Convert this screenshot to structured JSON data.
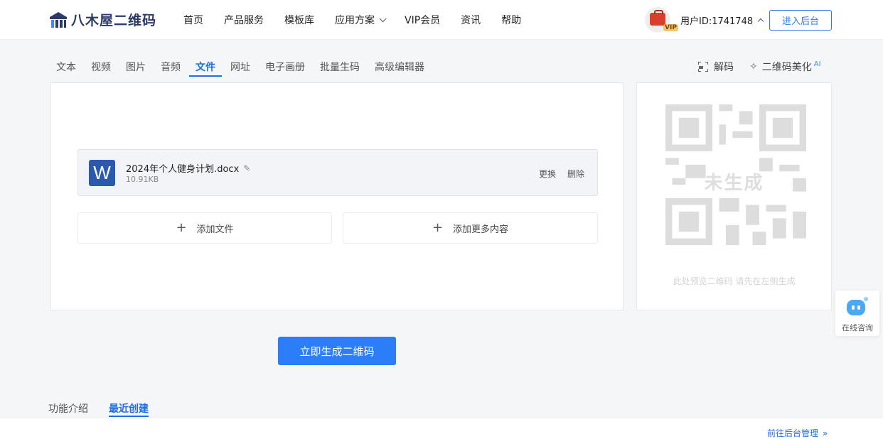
{
  "header": {
    "logo_text": "八木屋二维码",
    "nav": [
      {
        "label": "首页"
      },
      {
        "label": "产品服务"
      },
      {
        "label": "模板库"
      },
      {
        "label": "应用方案"
      },
      {
        "label": "VIP会员"
      },
      {
        "label": "资讯"
      },
      {
        "label": "帮助"
      }
    ],
    "user_id": "用户ID:1741748",
    "vip_badge": "VIP",
    "enter_button": "进入后台"
  },
  "tabs": [
    {
      "label": "文本"
    },
    {
      "label": "视频"
    },
    {
      "label": "图片"
    },
    {
      "label": "音频"
    },
    {
      "label": "文件",
      "active": true
    },
    {
      "label": "网址"
    },
    {
      "label": "电子画册"
    },
    {
      "label": "批量生码"
    },
    {
      "label": "高级编辑器"
    }
  ],
  "tools": {
    "decode": "解码",
    "beautify": "二维码美化",
    "ai_tag": "AI"
  },
  "file": {
    "icon_letter": "W",
    "name": "2024年个人健身计划.docx",
    "size": "10.91KB",
    "replace": "更换",
    "delete": "删除"
  },
  "actions": {
    "add_file": "添加文件",
    "add_more": "添加更多内容"
  },
  "preview": {
    "status": "未生成",
    "hint": "此处预览二维码 请先在左侧生成"
  },
  "consult": {
    "label": "在线咨询"
  },
  "generate_button": "立即生成二维码",
  "bottom_tabs": [
    {
      "label": "功能介绍"
    },
    {
      "label": "最近创建",
      "active": true
    }
  ],
  "manage_link": "前往后台管理",
  "colors": {
    "accent": "#2c7ef8",
    "active_tab": "#1f6fe0",
    "word_blue": "#2a5aad"
  }
}
